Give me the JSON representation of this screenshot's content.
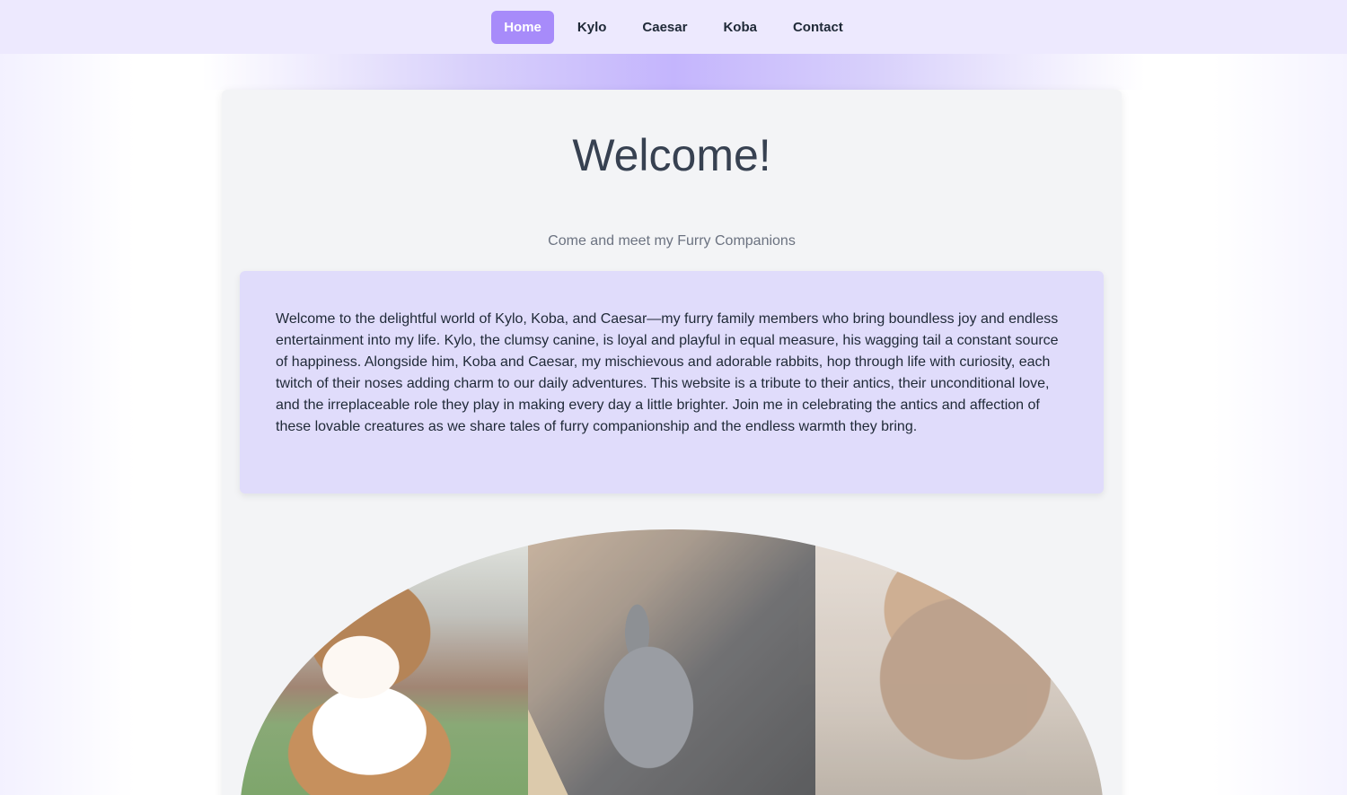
{
  "nav": {
    "items": [
      {
        "label": "Home",
        "active": true
      },
      {
        "label": "Kylo",
        "active": false
      },
      {
        "label": "Caesar",
        "active": false
      },
      {
        "label": "Koba",
        "active": false
      },
      {
        "label": "Contact",
        "active": false
      }
    ]
  },
  "main": {
    "title": "Welcome!",
    "subtitle": "Come and meet my Furry Companions",
    "intro": "Welcome to the delightful world of Kylo, Koba, and Caesar—my furry family members who bring boundless joy and endless entertainment into my life. Kylo, the clumsy canine, is loyal and playful in equal measure, his wagging tail a constant source of happiness. Alongside him, Koba and Caesar, my mischievous and adorable rabbits, hop through life with curiosity, each twitch of their noses adding charm to our daily adventures. This website is a tribute to their antics, their unconditional love, and the irreplaceable role they play in making every day a little brighter. Join me in celebrating the antics and affection of these lovable creatures as we share tales of furry companionship and the endless warmth they bring."
  },
  "colors": {
    "nav_bg": "#ede9fe",
    "accent": "#a78bfa",
    "intro_bg": "#e0dcfb",
    "card_bg": "#f3f4f6"
  }
}
